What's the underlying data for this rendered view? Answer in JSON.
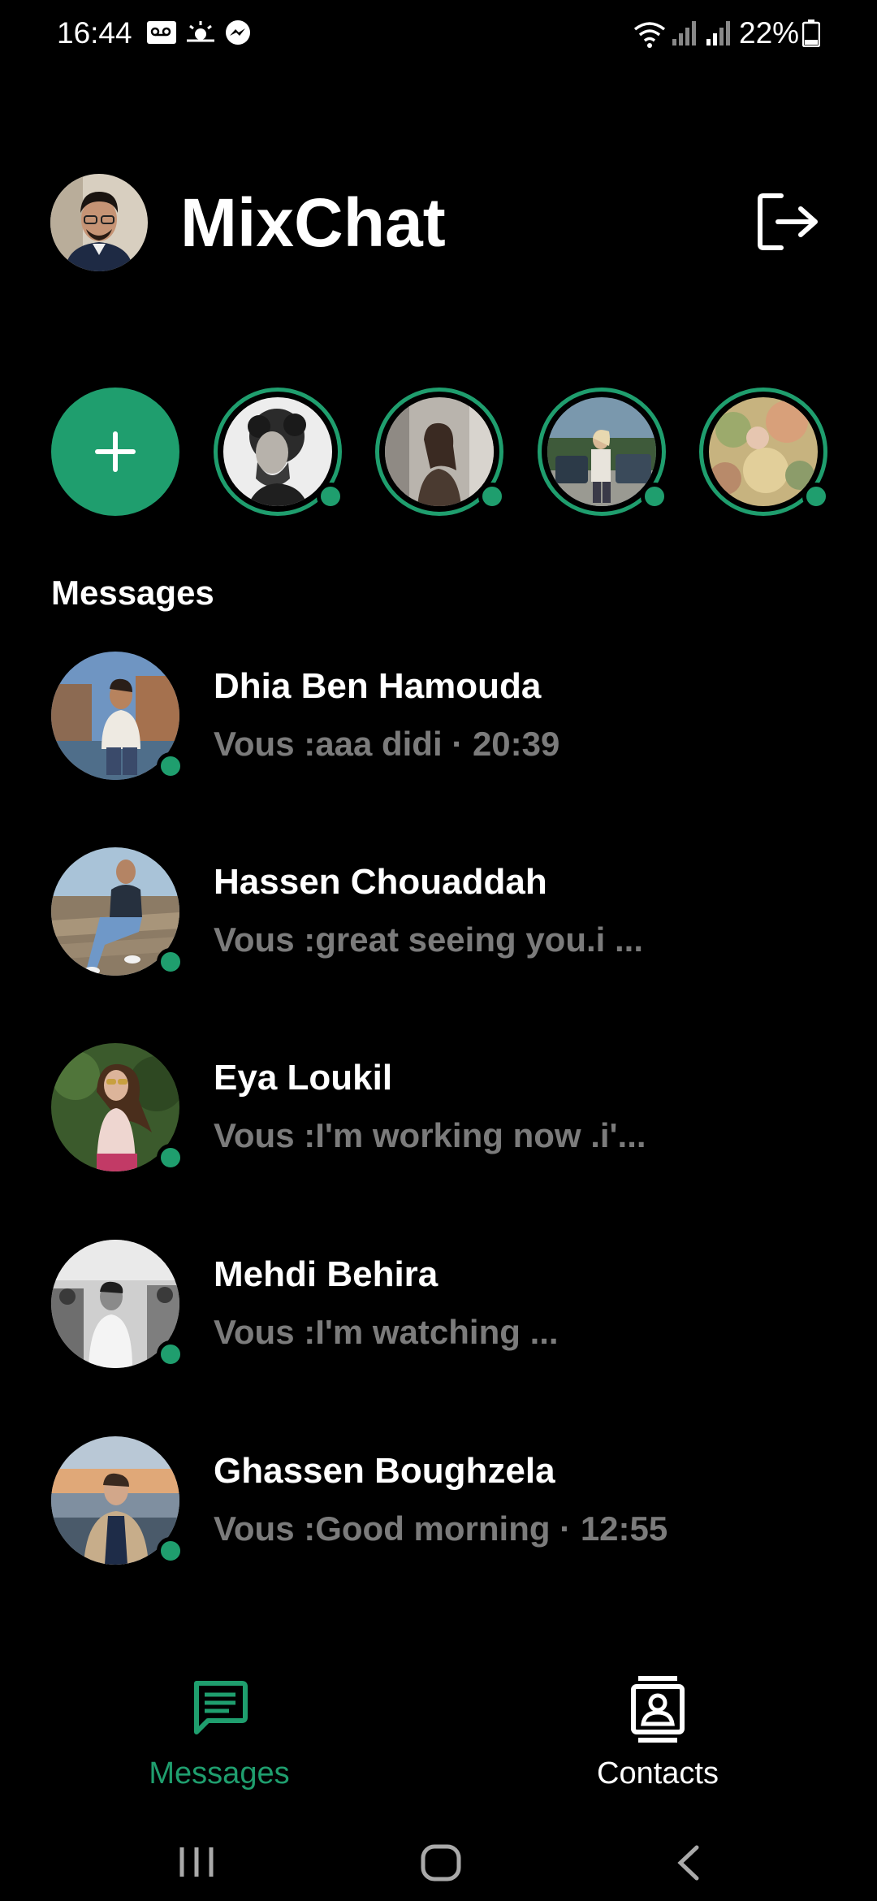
{
  "status_bar": {
    "time": "16:44",
    "battery_percent": "22%",
    "left_icons": [
      "voicemail-icon",
      "weather-icon",
      "messenger-icon"
    ],
    "right_icons": [
      "wifi-icon",
      "signal-icon",
      "signal-icon",
      "battery-icon"
    ]
  },
  "header": {
    "title": "MixChat",
    "logout_icon": "logout-icon"
  },
  "stories": {
    "add_icon": "plus-icon",
    "items": [
      {
        "online": true,
        "photo_colors": [
          "#e8e8e8",
          "#3a3a3a"
        ]
      },
      {
        "online": true,
        "photo_colors": [
          "#a9a49c",
          "#4a3a32"
        ]
      },
      {
        "online": true,
        "photo_colors": [
          "#6b8a9c",
          "#3c4a3a"
        ]
      },
      {
        "online": true,
        "photo_colors": [
          "#b8a67a",
          "#7a8c5c"
        ]
      }
    ]
  },
  "messages": {
    "title": "Messages",
    "items": [
      {
        "name": "Dhia Ben Hamouda",
        "preview": "Vous :aaa didi  · 20:39",
        "online": true,
        "photo_colors": [
          "#6f8fb5",
          "#8a5a3c"
        ]
      },
      {
        "name": "Hassen Chouaddah",
        "preview": "Vous :great seeing you.i ...",
        "online": true,
        "photo_colors": [
          "#9fb5c9",
          "#7a6a58"
        ]
      },
      {
        "name": "Eya Loukil",
        "preview": "Vous :I'm working now .i'...",
        "online": true,
        "photo_colors": [
          "#3d5a2a",
          "#c8a58a"
        ]
      },
      {
        "name": "Mehdi Behira",
        "preview": "Vous :I'm watching ...",
        "online": true,
        "photo_colors": [
          "#c8c8c8",
          "#3a3a3a"
        ]
      },
      {
        "name": "Ghassen Boughzela",
        "preview": "Vous :Good morning · 12:55",
        "online": true,
        "photo_colors": [
          "#c9a57a",
          "#2a3a5a"
        ]
      }
    ]
  },
  "bottom_nav": {
    "items": [
      {
        "label": "Messages",
        "icon": "chat-icon",
        "active": true
      },
      {
        "label": "Contacts",
        "icon": "contacts-icon",
        "active": false
      }
    ]
  },
  "system_nav": {
    "icons": [
      "recents-icon",
      "home-icon",
      "back-icon"
    ]
  },
  "colors": {
    "accent": "#1f9e6e",
    "background": "#000000",
    "preview_text": "#7b7b7b"
  }
}
